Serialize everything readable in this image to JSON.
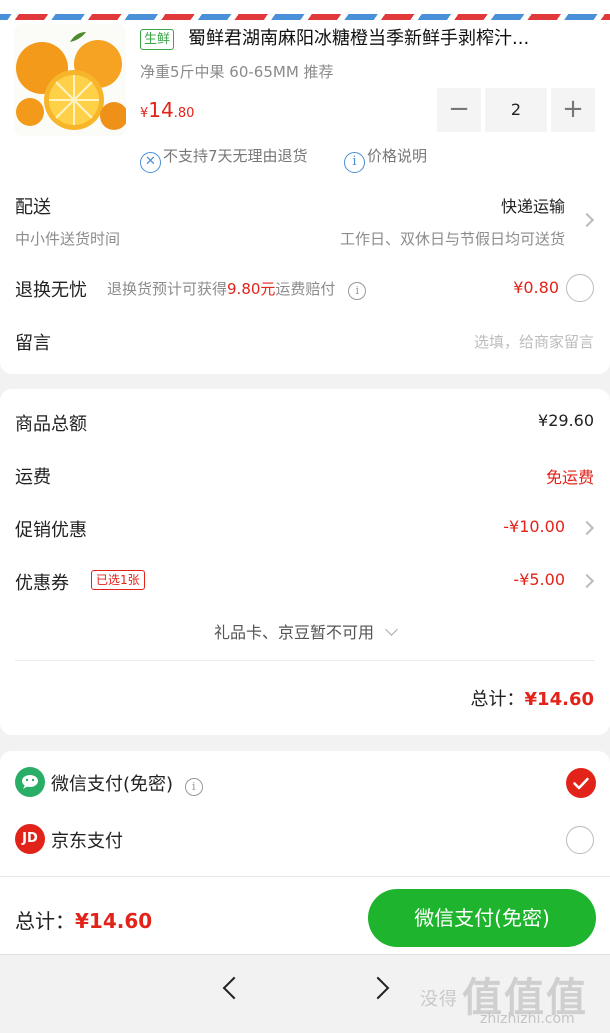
{
  "product": {
    "tag": "生鲜",
    "title": "蜀鲜君湖南麻阳冰糖橙当季新鲜手剥榨汁...",
    "spec": "净重5斤中果 60-65MM 推荐",
    "price_currency": "¥",
    "price_int": "14",
    "price_dec": ".80",
    "quantity": "2",
    "minus_symbol": "−",
    "plus_symbol": "+",
    "service_no_return": "不支持7天无理由退货",
    "service_price_note": "价格说明"
  },
  "delivery": {
    "label": "配送",
    "method": "快递运输",
    "sub_left": "中小件送货时间",
    "sub_right": "工作日、双休日与节假日均可送货"
  },
  "return_worry_free": {
    "label": "退换无忧",
    "desc_prefix": "退换货预计可获得",
    "desc_amount": "9.80元",
    "desc_suffix": "运费赔付",
    "price": "¥0.80"
  },
  "message": {
    "label": "留言",
    "placeholder": "选填，给商家留言"
  },
  "summary": {
    "goods_total_label": "商品总额",
    "goods_total": "¥29.60",
    "shipping_label": "运费",
    "shipping_value": "免运费",
    "promo_label": "促销优惠",
    "promo_value": "-¥10.00",
    "coupon_label": "优惠券",
    "coupon_badge": "已选1张",
    "coupon_value": "-¥5.00",
    "giftcard_note": "礼品卡、京豆暂不可用",
    "total_label": "总计：",
    "total_value": "¥14.60"
  },
  "payment": {
    "wechat_label": "微信支付(免密)",
    "jd_icon_text": "JD",
    "jd_label": "京东支付",
    "wechat_selected": true
  },
  "bottom_bar": {
    "total_label": "总计：",
    "total_value": "¥14.60",
    "pay_button": "微信支付(免密)"
  },
  "watermark": {
    "text": "没得",
    "logo": "值值值",
    "url": "zhizhizhi.com"
  },
  "colors": {
    "accent_red": "#e2231a",
    "wechat_green": "#1fb42d",
    "tag_green": "#3aa54a",
    "service_blue": "#4a8fd6"
  }
}
